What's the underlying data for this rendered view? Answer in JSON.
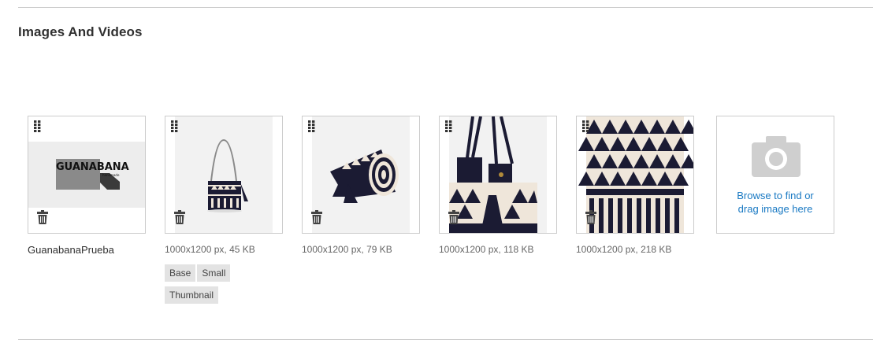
{
  "section": {
    "title": "Images And Videos"
  },
  "images": [
    {
      "kind": "logo",
      "logo_text": "GUANABANA",
      "logo_subtext": "handmade",
      "caption": "GuanabanaPrueba",
      "meta": "",
      "roles": []
    },
    {
      "kind": "bucket",
      "caption": "",
      "meta": "1000x1200 px, 45 KB",
      "roles": [
        "Base",
        "Small",
        "Thumbnail"
      ]
    },
    {
      "kind": "cylinder",
      "caption": "",
      "meta": "1000x1200 px, 79 KB",
      "roles": []
    },
    {
      "kind": "closeup",
      "caption": "",
      "meta": "1000x1200 px, 118 KB",
      "roles": []
    },
    {
      "kind": "pattern",
      "caption": "",
      "meta": "1000x1200 px, 218 KB",
      "roles": []
    }
  ],
  "uploader": {
    "line1": "Browse to find or",
    "line2": "drag image here"
  },
  "colors": {
    "link": "#1979c3",
    "border": "#cccccc",
    "role_bg": "#e3e3e3",
    "bag_dark": "#1b1b33",
    "bag_light": "#efe6da"
  }
}
